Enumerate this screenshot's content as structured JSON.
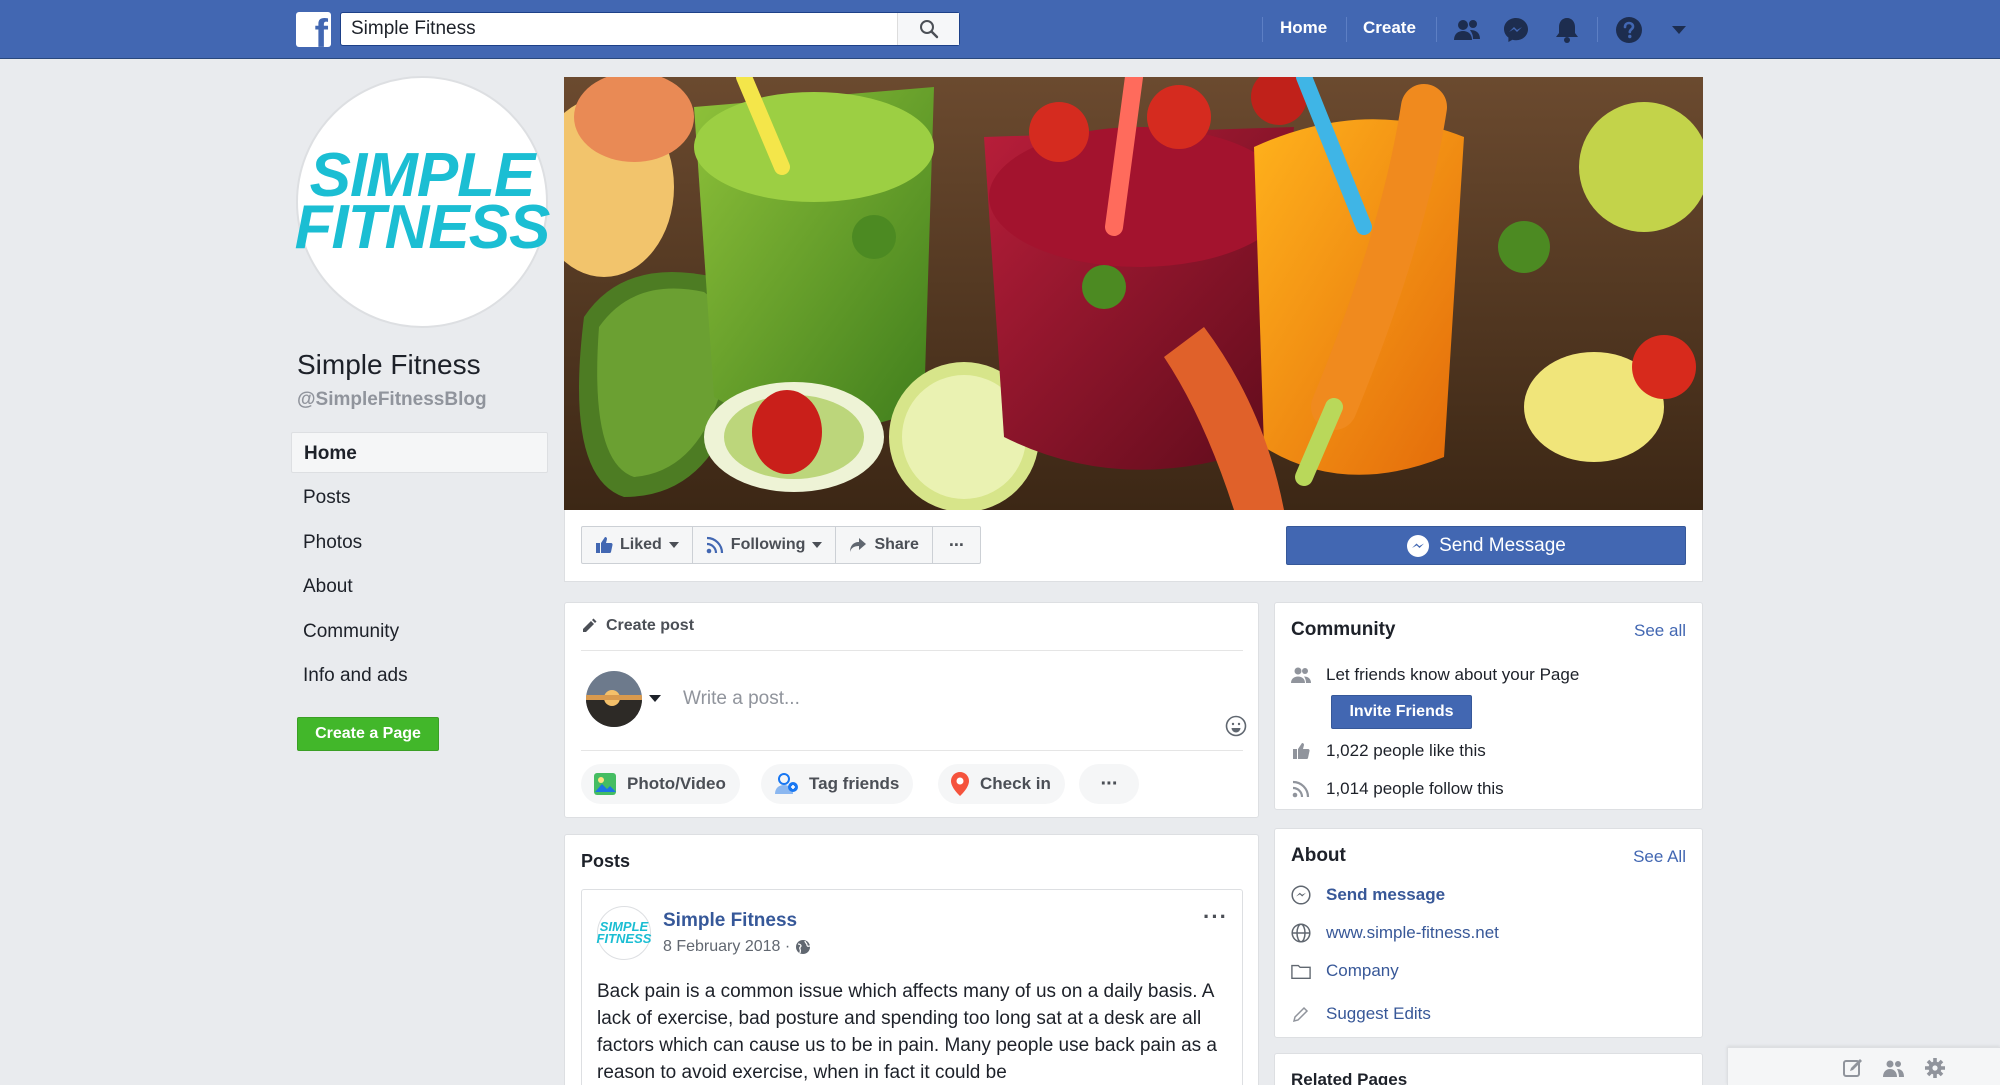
{
  "topbar": {
    "logo_letter": "f",
    "search_value": "Simple Fitness",
    "nav_home": "Home",
    "nav_create": "Create",
    "icons": [
      "friend-requests-icon",
      "messenger-icon",
      "notifications-icon",
      "help-icon",
      "account-menu-icon"
    ]
  },
  "profile": {
    "logo_line1": "SIMPLE",
    "logo_line2": "FITNESS",
    "name": "Simple Fitness",
    "handle": "@SimpleFitnessBlog"
  },
  "sidebar": {
    "items": [
      {
        "label": "Home",
        "active": true
      },
      {
        "label": "Posts"
      },
      {
        "label": "Photos"
      },
      {
        "label": "About"
      },
      {
        "label": "Community"
      },
      {
        "label": "Info and ads"
      }
    ],
    "create_page": "Create a Page"
  },
  "actions": {
    "liked": "Liked",
    "following": "Following",
    "share": "Share",
    "more": "···",
    "send_message": "Send Message"
  },
  "create_post": {
    "header": "Create post",
    "placeholder": "Write a post...",
    "chips": [
      "Photo/Video",
      "Tag friends",
      "Check in",
      "···"
    ]
  },
  "posts": {
    "title": "Posts",
    "post": {
      "avatar_line1": "SIMPLE",
      "avatar_line2": "FITNESS",
      "author": "Simple Fitness",
      "date": "8 February 2018 ·",
      "more": "···",
      "text": "Back pain is a common issue which affects many of us on a daily basis. A lack of exercise, bad posture and spending too long sat at a desk are all factors which can cause us to be in pain. Many people use back pain as a reason to avoid exercise, when in fact it could be"
    }
  },
  "community": {
    "title": "Community",
    "see_all": "See all",
    "invite_text": "Let friends know about your Page",
    "invite_button": "Invite Friends",
    "likes": "1,022 people like this",
    "follows": "1,014 people follow this"
  },
  "about": {
    "title": "About",
    "see_all": "See All",
    "send_message": "Send message",
    "website": "www.simple-fitness.net",
    "category": "Company",
    "suggest": "Suggest Edits"
  },
  "related": {
    "title": "Related Pages"
  },
  "colors": {
    "brand_blue": "#4267b2",
    "logo_teal": "#1bbed3",
    "green": "#42b72a",
    "link": "#385898"
  }
}
